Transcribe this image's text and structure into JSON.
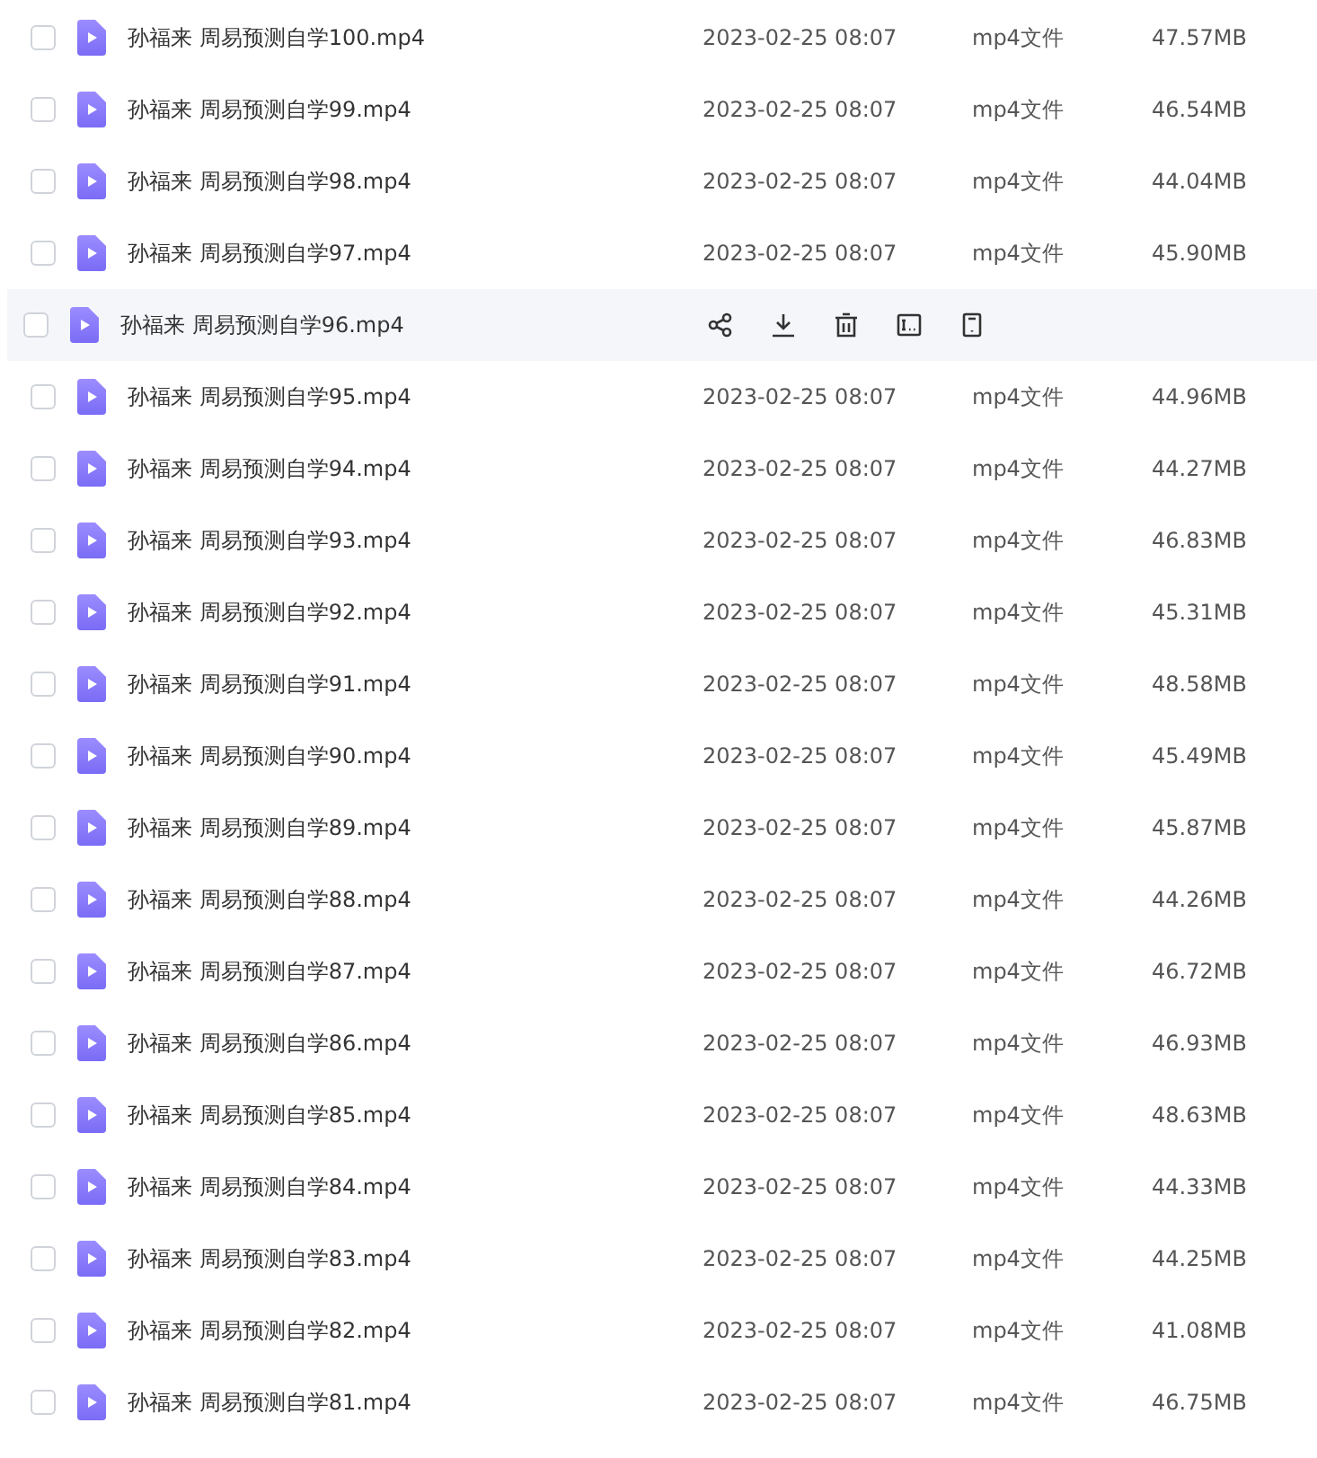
{
  "files": [
    {
      "name": "孙福来 周易预测自学100.mp4",
      "hovered": false,
      "checked": false,
      "date": "2023-02-25 08:07",
      "type": "mp4文件",
      "size": "47.57MB"
    },
    {
      "name": "孙福来 周易预测自学99.mp4",
      "hovered": false,
      "checked": false,
      "date": "2023-02-25 08:07",
      "type": "mp4文件",
      "size": "46.54MB"
    },
    {
      "name": "孙福来 周易预测自学98.mp4",
      "hovered": false,
      "checked": false,
      "date": "2023-02-25 08:07",
      "type": "mp4文件",
      "size": "44.04MB"
    },
    {
      "name": "孙福来 周易预测自学97.mp4",
      "hovered": false,
      "checked": false,
      "date": "2023-02-25 08:07",
      "type": "mp4文件",
      "size": "45.90MB"
    },
    {
      "name": "孙福来 周易预测自学96.mp4",
      "hovered": true,
      "checked": false
    },
    {
      "name": "孙福来 周易预测自学95.mp4",
      "hovered": false,
      "checked": false,
      "date": "2023-02-25 08:07",
      "type": "mp4文件",
      "size": "44.96MB"
    },
    {
      "name": "孙福来 周易预测自学94.mp4",
      "hovered": false,
      "checked": false,
      "date": "2023-02-25 08:07",
      "type": "mp4文件",
      "size": "44.27MB"
    },
    {
      "name": "孙福来 周易预测自学93.mp4",
      "hovered": false,
      "checked": false,
      "date": "2023-02-25 08:07",
      "type": "mp4文件",
      "size": "46.83MB"
    },
    {
      "name": "孙福来 周易预测自学92.mp4",
      "hovered": false,
      "checked": false,
      "date": "2023-02-25 08:07",
      "type": "mp4文件",
      "size": "45.31MB"
    },
    {
      "name": "孙福来 周易预测自学91.mp4",
      "hovered": false,
      "checked": false,
      "date": "2023-02-25 08:07",
      "type": "mp4文件",
      "size": "48.58MB"
    },
    {
      "name": "孙福来 周易预测自学90.mp4",
      "hovered": false,
      "checked": false,
      "date": "2023-02-25 08:07",
      "type": "mp4文件",
      "size": "45.49MB"
    },
    {
      "name": "孙福来 周易预测自学89.mp4",
      "hovered": false,
      "checked": false,
      "date": "2023-02-25 08:07",
      "type": "mp4文件",
      "size": "45.87MB"
    },
    {
      "name": "孙福来 周易预测自学88.mp4",
      "hovered": false,
      "checked": false,
      "date": "2023-02-25 08:07",
      "type": "mp4文件",
      "size": "44.26MB"
    },
    {
      "name": "孙福来 周易预测自学87.mp4",
      "hovered": false,
      "checked": false,
      "date": "2023-02-25 08:07",
      "type": "mp4文件",
      "size": "46.72MB"
    },
    {
      "name": "孙福来 周易预测自学86.mp4",
      "hovered": false,
      "checked": false,
      "date": "2023-02-25 08:07",
      "type": "mp4文件",
      "size": "46.93MB"
    },
    {
      "name": "孙福来 周易预测自学85.mp4",
      "hovered": false,
      "checked": false,
      "date": "2023-02-25 08:07",
      "type": "mp4文件",
      "size": "48.63MB"
    },
    {
      "name": "孙福来 周易预测自学84.mp4",
      "hovered": false,
      "checked": false,
      "date": "2023-02-25 08:07",
      "type": "mp4文件",
      "size": "44.33MB"
    },
    {
      "name": "孙福来 周易预测自学83.mp4",
      "hovered": false,
      "checked": false,
      "date": "2023-02-25 08:07",
      "type": "mp4文件",
      "size": "44.25MB"
    },
    {
      "name": "孙福来 周易预测自学82.mp4",
      "hovered": false,
      "checked": false,
      "date": "2023-02-25 08:07",
      "type": "mp4文件",
      "size": "41.08MB"
    },
    {
      "name": "孙福来 周易预测自学81.mp4",
      "hovered": false,
      "checked": false,
      "date": "2023-02-25 08:07",
      "type": "mp4文件",
      "size": "46.75MB"
    }
  ]
}
